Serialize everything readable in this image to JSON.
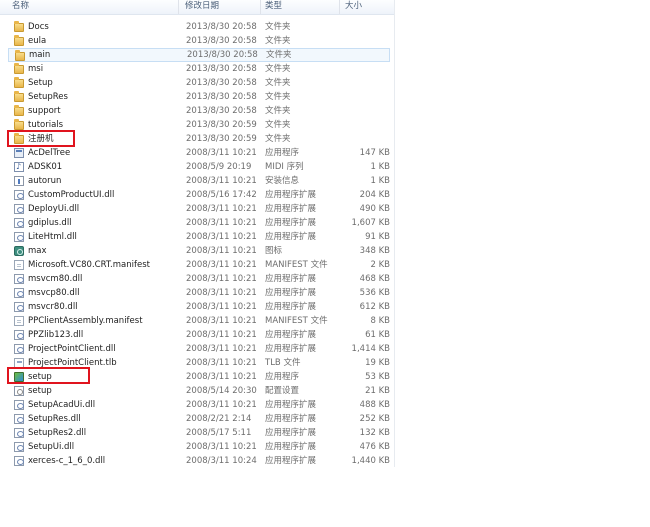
{
  "columns": {
    "name": "名称",
    "date": "修改日期",
    "type": "类型",
    "size": "大小"
  },
  "files": [
    {
      "name": "Docs",
      "date": "2013/8/30 20:58",
      "type": "文件夹",
      "size": "",
      "icon": "folder-icon"
    },
    {
      "name": "eula",
      "date": "2013/8/30 20:58",
      "type": "文件夹",
      "size": "",
      "icon": "folder-icon"
    },
    {
      "name": "main",
      "date": "2013/8/30 20:58",
      "type": "文件夹",
      "size": "",
      "icon": "folder-icon"
    },
    {
      "name": "msi",
      "date": "2013/8/30 20:58",
      "type": "文件夹",
      "size": "",
      "icon": "folder-icon"
    },
    {
      "name": "Setup",
      "date": "2013/8/30 20:58",
      "type": "文件夹",
      "size": "",
      "icon": "folder-icon"
    },
    {
      "name": "SetupRes",
      "date": "2013/8/30 20:58",
      "type": "文件夹",
      "size": "",
      "icon": "folder-icon"
    },
    {
      "name": "support",
      "date": "2013/8/30 20:58",
      "type": "文件夹",
      "size": "",
      "icon": "folder-icon"
    },
    {
      "name": "tutorials",
      "date": "2013/8/30 20:59",
      "type": "文件夹",
      "size": "",
      "icon": "folder-icon"
    },
    {
      "name": "注册机",
      "date": "2013/8/30 20:59",
      "type": "文件夹",
      "size": "",
      "icon": "folder-icon"
    },
    {
      "name": "AcDelTree",
      "date": "2008/3/11 10:21",
      "type": "应用程序",
      "size": "147 KB",
      "icon": "application-icon"
    },
    {
      "name": "ADSK01",
      "date": "2008/5/9 20:19",
      "type": "MIDI 序列",
      "size": "1 KB",
      "icon": "midi-file-icon"
    },
    {
      "name": "autorun",
      "date": "2008/3/11 10:21",
      "type": "安装信息",
      "size": "1 KB",
      "icon": "setup-info-icon"
    },
    {
      "name": "CustomProductUI.dll",
      "date": "2008/5/16 17:42",
      "type": "应用程序扩展",
      "size": "204 KB",
      "icon": "dll-icon"
    },
    {
      "name": "DeployUi.dll",
      "date": "2008/3/11 10:21",
      "type": "应用程序扩展",
      "size": "490 KB",
      "icon": "dll-icon"
    },
    {
      "name": "gdiplus.dll",
      "date": "2008/3/11 10:21",
      "type": "应用程序扩展",
      "size": "1,607 KB",
      "icon": "dll-icon"
    },
    {
      "name": "LiteHtml.dll",
      "date": "2008/3/11 10:21",
      "type": "应用程序扩展",
      "size": "91 KB",
      "icon": "dll-icon"
    },
    {
      "name": "max",
      "date": "2008/3/11 10:21",
      "type": "图标",
      "size": "348 KB",
      "icon": "max-icon"
    },
    {
      "name": "Microsoft.VC80.CRT.manifest",
      "date": "2008/3/11 10:21",
      "type": "MANIFEST 文件",
      "size": "2 KB",
      "icon": "manifest-file-icon"
    },
    {
      "name": "msvcm80.dll",
      "date": "2008/3/11 10:21",
      "type": "应用程序扩展",
      "size": "468 KB",
      "icon": "dll-icon"
    },
    {
      "name": "msvcp80.dll",
      "date": "2008/3/11 10:21",
      "type": "应用程序扩展",
      "size": "536 KB",
      "icon": "dll-icon"
    },
    {
      "name": "msvcr80.dll",
      "date": "2008/3/11 10:21",
      "type": "应用程序扩展",
      "size": "612 KB",
      "icon": "dll-icon"
    },
    {
      "name": "PPClientAssembly.manifest",
      "date": "2008/3/11 10:21",
      "type": "MANIFEST 文件",
      "size": "8 KB",
      "icon": "manifest-file-icon"
    },
    {
      "name": "PPZlib123.dll",
      "date": "2008/3/11 10:21",
      "type": "应用程序扩展",
      "size": "61 KB",
      "icon": "dll-icon"
    },
    {
      "name": "ProjectPointClient.dll",
      "date": "2008/3/11 10:21",
      "type": "应用程序扩展",
      "size": "1,414 KB",
      "icon": "dll-icon"
    },
    {
      "name": "ProjectPointClient.tlb",
      "date": "2008/3/11 10:21",
      "type": "TLB 文件",
      "size": "19 KB",
      "icon": "tlb-file-icon"
    },
    {
      "name": "setup",
      "date": "2008/3/11 10:21",
      "type": "应用程序",
      "size": "53 KB",
      "icon": "setup-exe-icon"
    },
    {
      "name": "setup",
      "date": "2008/5/14 20:30",
      "type": "配置设置",
      "size": "21 KB",
      "icon": "config-settings-icon"
    },
    {
      "name": "SetupAcadUi.dll",
      "date": "2008/3/11 10:21",
      "type": "应用程序扩展",
      "size": "488 KB",
      "icon": "dll-icon"
    },
    {
      "name": "SetupRes.dll",
      "date": "2008/2/21 2:14",
      "type": "应用程序扩展",
      "size": "252 KB",
      "icon": "dll-icon"
    },
    {
      "name": "SetupRes2.dll",
      "date": "2008/5/17 5:11",
      "type": "应用程序扩展",
      "size": "132 KB",
      "icon": "dll-icon"
    },
    {
      "name": "SetupUi.dll",
      "date": "2008/3/11 10:21",
      "type": "应用程序扩展",
      "size": "476 KB",
      "icon": "dll-icon"
    },
    {
      "name": "xerces-c_1_6_0.dll",
      "date": "2008/3/11 10:24",
      "type": "应用程序扩展",
      "size": "1,440 KB",
      "icon": "dll-icon"
    }
  ],
  "selected_index": 2,
  "highlighted": [
    "注册机",
    "setup"
  ],
  "colors": {
    "highlight_box": "#e0141e",
    "selection": "#c7def4",
    "folder": "#e9b64a"
  }
}
